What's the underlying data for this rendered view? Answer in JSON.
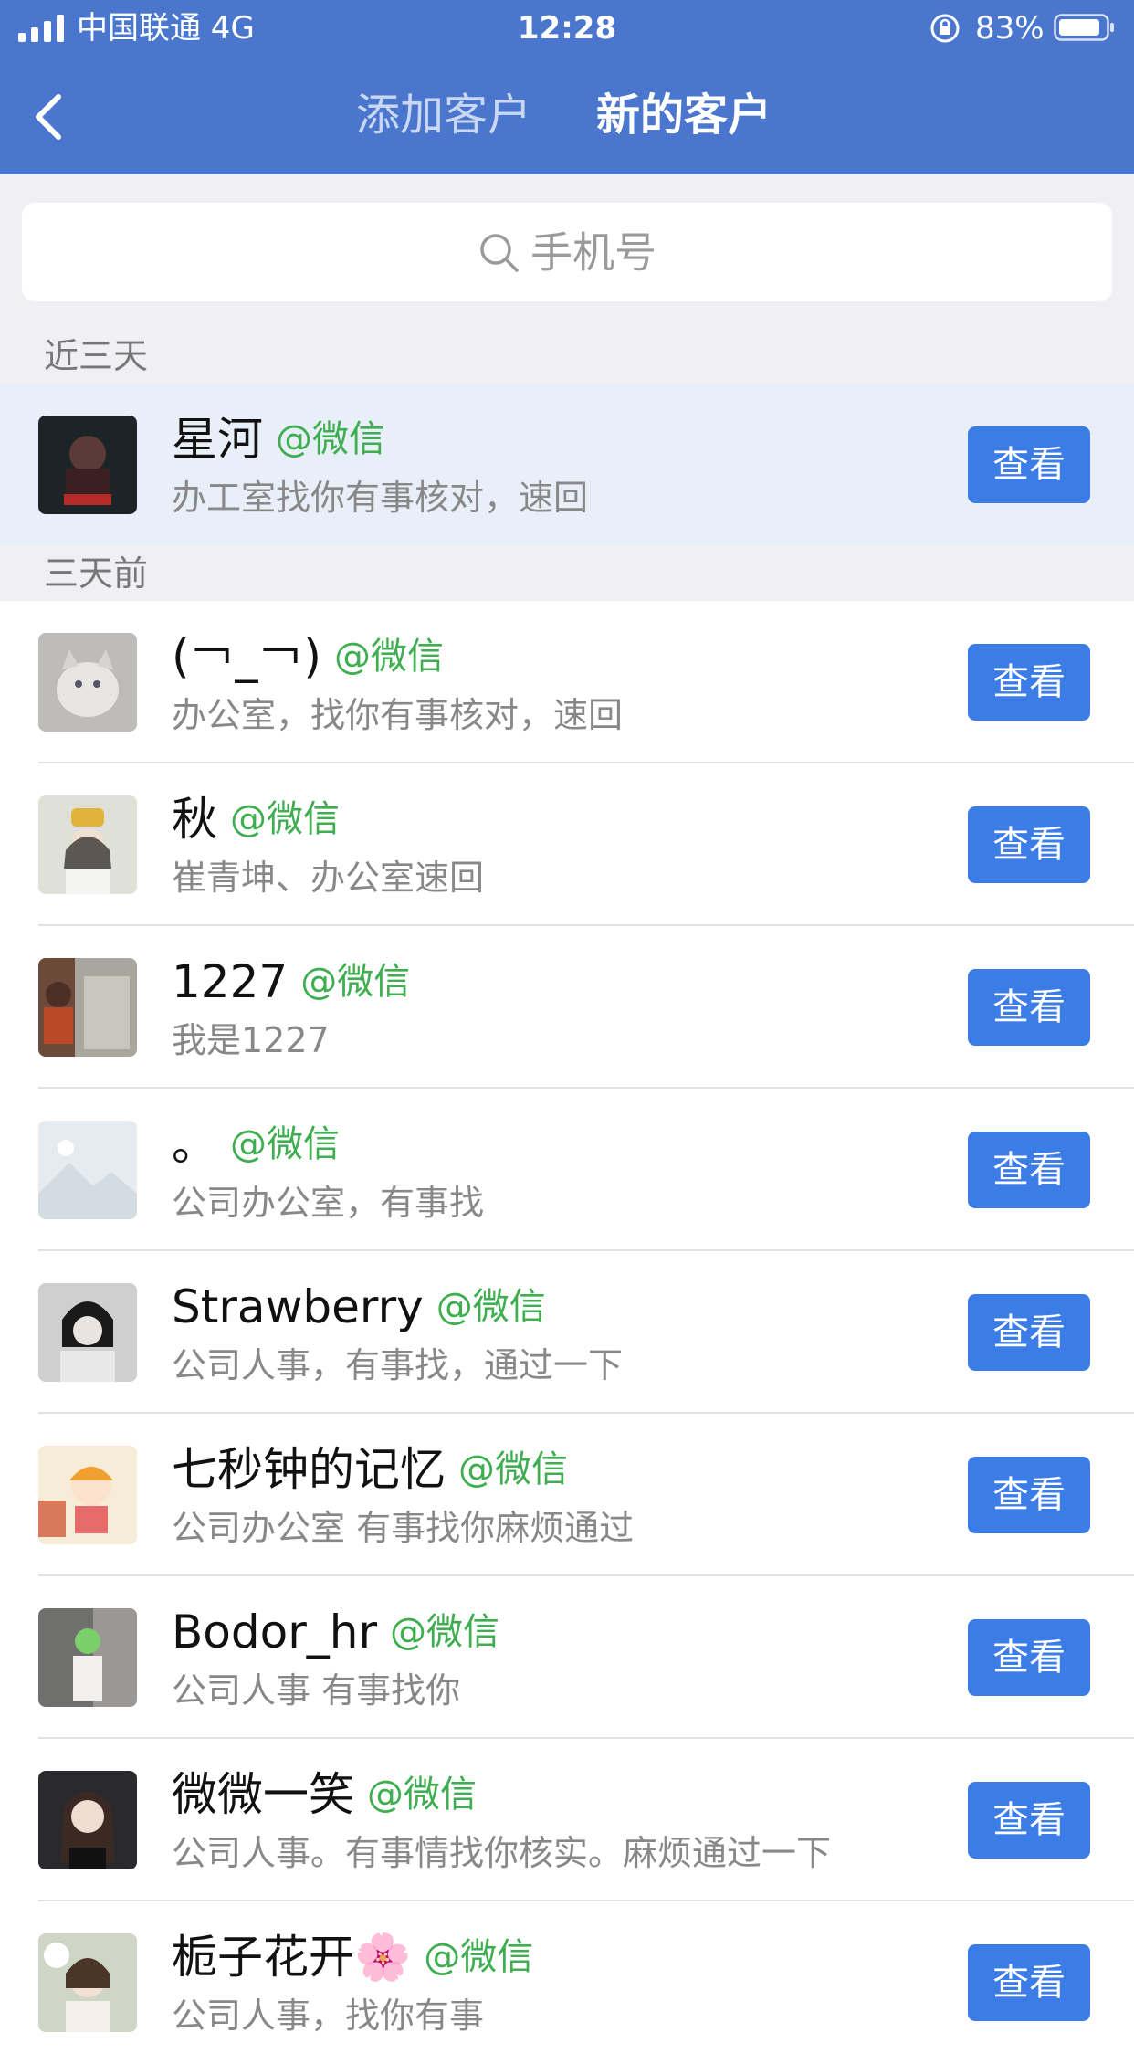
{
  "status_bar": {
    "carrier": "中国联通  4G",
    "time": "12:28",
    "battery": "83%"
  },
  "nav": {
    "tab_add": "添加客户",
    "tab_new": "新的客户"
  },
  "search": {
    "placeholder": "手机号"
  },
  "sections": {
    "recent": "近三天",
    "older": "三天前"
  },
  "view_label": "查看",
  "recent_items": [
    {
      "name": "星河",
      "source": "@微信",
      "message": "办工室找你有事核对，速回"
    }
  ],
  "older_items": [
    {
      "name": "(￢_￢)",
      "source": "@微信",
      "message": "办公室，找你有事核对，速回"
    },
    {
      "name": "秋",
      "source": "@微信",
      "message": "崔青坤、办公室速回"
    },
    {
      "name": "1227",
      "source": "@微信",
      "message": "我是1227"
    },
    {
      "name": "。",
      "source": "@微信",
      "message": "公司办公室，有事找"
    },
    {
      "name": "Strawberry",
      "source": "@微信",
      "message": "公司人事，有事找，通过一下"
    },
    {
      "name": "七秒钟的记忆",
      "source": "@微信",
      "message": "公司办公室 有事找你麻烦通过"
    },
    {
      "name": "Bodor_hr",
      "source": "@微信",
      "message": "公司人事 有事找你"
    },
    {
      "name": "微微一笑",
      "source": "@微信",
      "message": "公司人事。有事情找你核实。麻烦通过一下"
    },
    {
      "name": "栀子花开🌸",
      "source": "@微信",
      "message": "公司人事，找你有事"
    }
  ],
  "colors": {
    "header": "#4a77cd",
    "button": "#3c7ce6",
    "source_green": "#3fae50",
    "highlight_row": "#e9eff9"
  }
}
